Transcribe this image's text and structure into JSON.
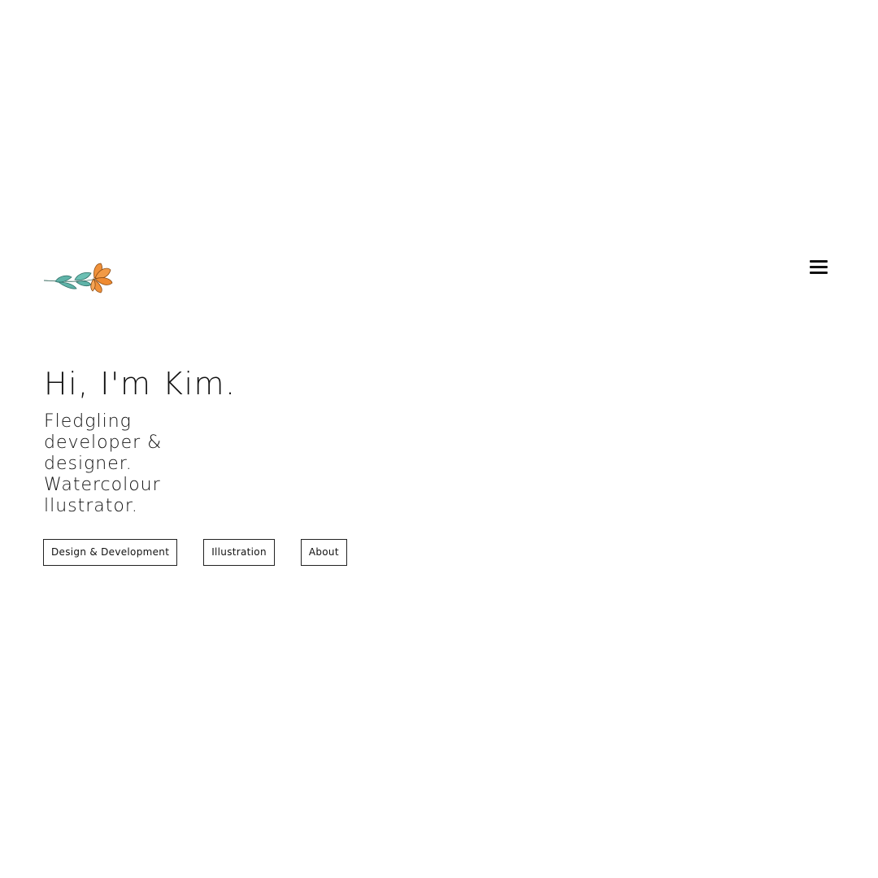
{
  "header": {
    "logo_icon": "flower-sprig-icon",
    "menu_icon": "hamburger-menu-icon"
  },
  "hero": {
    "greeting": "Hi, I'm Kim.",
    "tagline": "Fledgling developer & designer. Watercolour llustrator."
  },
  "nav_buttons": [
    {
      "label": "Design & Development"
    },
    {
      "label": "Illustration"
    },
    {
      "label": "About"
    }
  ],
  "colors": {
    "background": "#ffffff",
    "text": "#111111",
    "leaf": "#5fb3a8",
    "flower": "#f0913a"
  }
}
